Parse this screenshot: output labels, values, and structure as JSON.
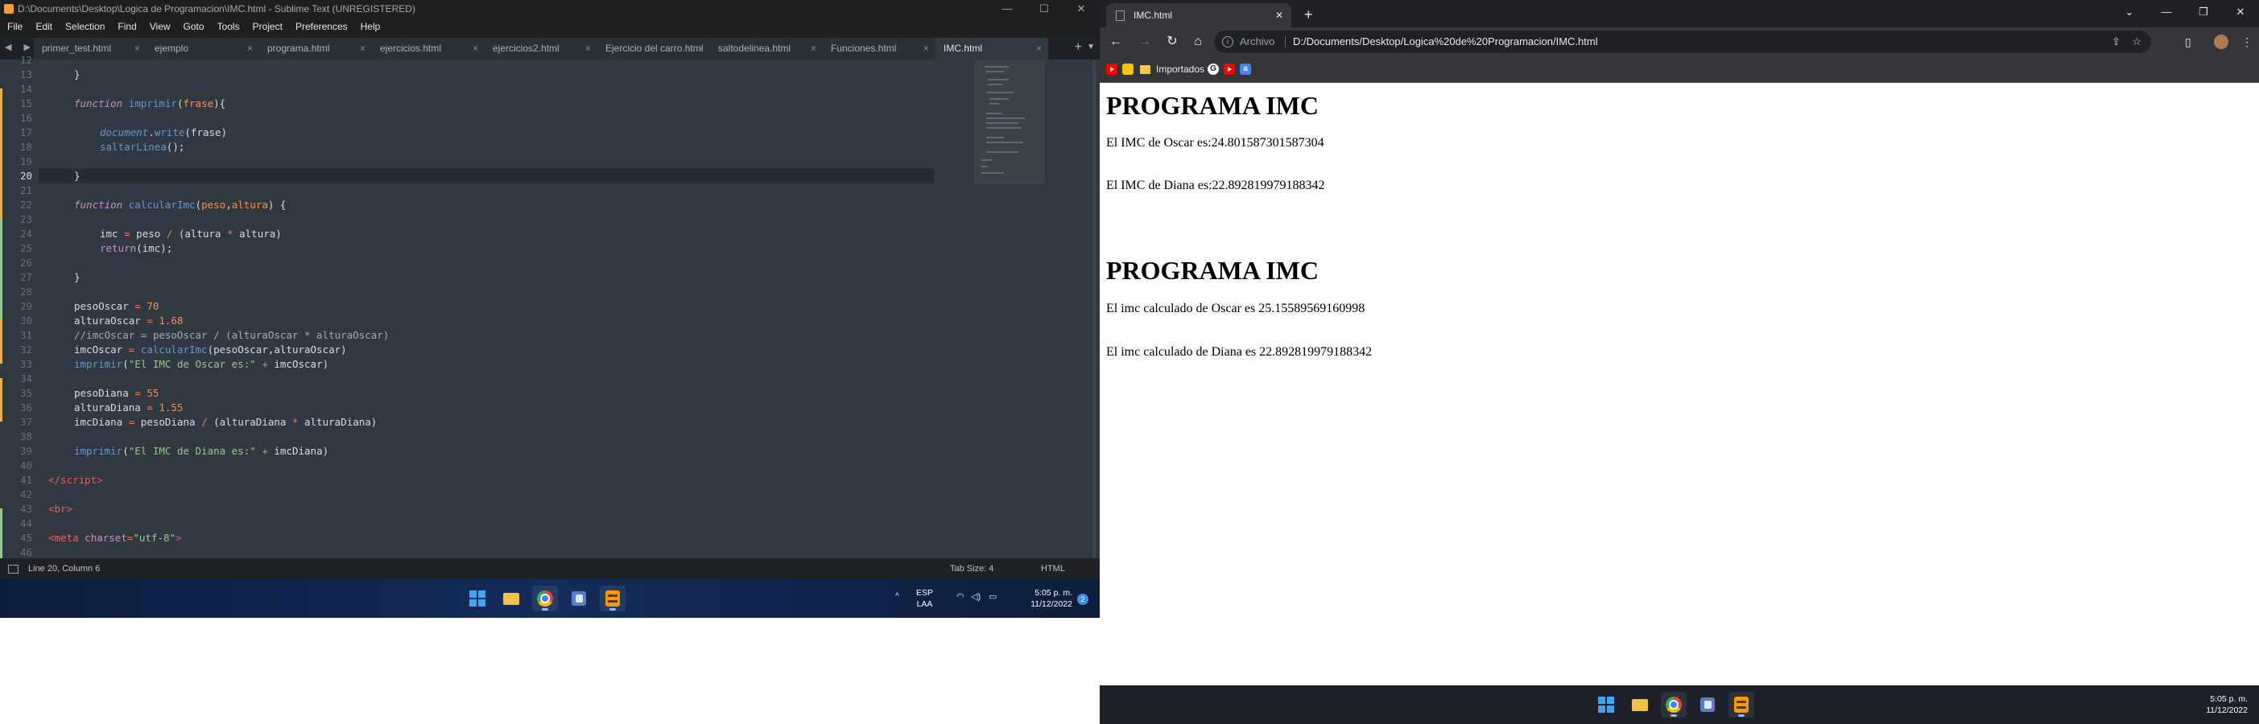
{
  "sublime": {
    "title": "D:\\Documents\\Desktop\\Logica de Programacion\\IMC.html - Sublime Text (UNREGISTERED)",
    "window_buttons": [
      "—",
      "☐",
      "✕"
    ],
    "menu": [
      "File",
      "Edit",
      "Selection",
      "Find",
      "View",
      "Goto",
      "Tools",
      "Project",
      "Preferences",
      "Help"
    ],
    "tabs": [
      "primer_test.html",
      "ejemplo",
      "programa.html",
      "ejercicios.html",
      "ejercicios2.html",
      "Ejercicio del carro.html",
      "saltodelinea.html",
      "Funciones.html",
      "IMC.html"
    ],
    "tab_close": "×",
    "tab_arrows": "◀ ▶",
    "tab_plus": "+",
    "tab_dropdown": "▼",
    "line_numbers": [
      "12",
      "13",
      "14",
      "15",
      "16",
      "17",
      "18",
      "19",
      "20",
      "21",
      "22",
      "23",
      "24",
      "25",
      "26",
      "27",
      "28",
      "29",
      "30",
      "31",
      "32",
      "33",
      "34",
      "35",
      "36",
      "37",
      "38",
      "39",
      "40",
      "41",
      "42",
      "43",
      "44",
      "45",
      "46"
    ],
    "current_line": "20",
    "status": {
      "position": "Line 20, Column 6",
      "tab_size": "Tab Size: 4",
      "syntax": "HTML"
    }
  },
  "taskbar_left": {
    "lang_top": "ESP",
    "lang_bottom": "LAA",
    "chevron": "^",
    "wifi": "◠",
    "volume": "◁)",
    "battery": "▭",
    "time": "5:05 p. m.",
    "date": "11/12/2022",
    "badge": "2"
  },
  "chrome": {
    "tab_title": "IMC.html",
    "tab_close": "✕",
    "new_tab": "+",
    "window_buttons": [
      "⌄",
      "—",
      "❐",
      "✕"
    ],
    "nav": {
      "back": "←",
      "forward": "→",
      "reload": "↻",
      "home": "⌂"
    },
    "info_icon": "i",
    "archivo_label": "Archivo",
    "url": "D:/Documents/Desktop/Logica%20de%20Programacion/IMC.html",
    "toolbar_right": {
      "share": "⇪",
      "star": "☆",
      "side": "▯",
      "menu": "⋮"
    },
    "bookmarks": {
      "folder_label": "Importados",
      "g_letter": "G",
      "a_letter": "a"
    }
  },
  "page": {
    "heading1": "PROGRAMA IMC",
    "line1": "El IMC de Oscar es:24.801587301587304",
    "line2": "El IMC de Diana es:22.892819979188342",
    "heading2": "PROGRAMA IMC",
    "line3": "El imc calculado de Oscar es 25.15589569160998",
    "line4": "El imc calculado de Diana es 22.892819979188342"
  },
  "taskbar_right": {
    "time": "5:05 p. m.",
    "date": "11/12/2022"
  }
}
